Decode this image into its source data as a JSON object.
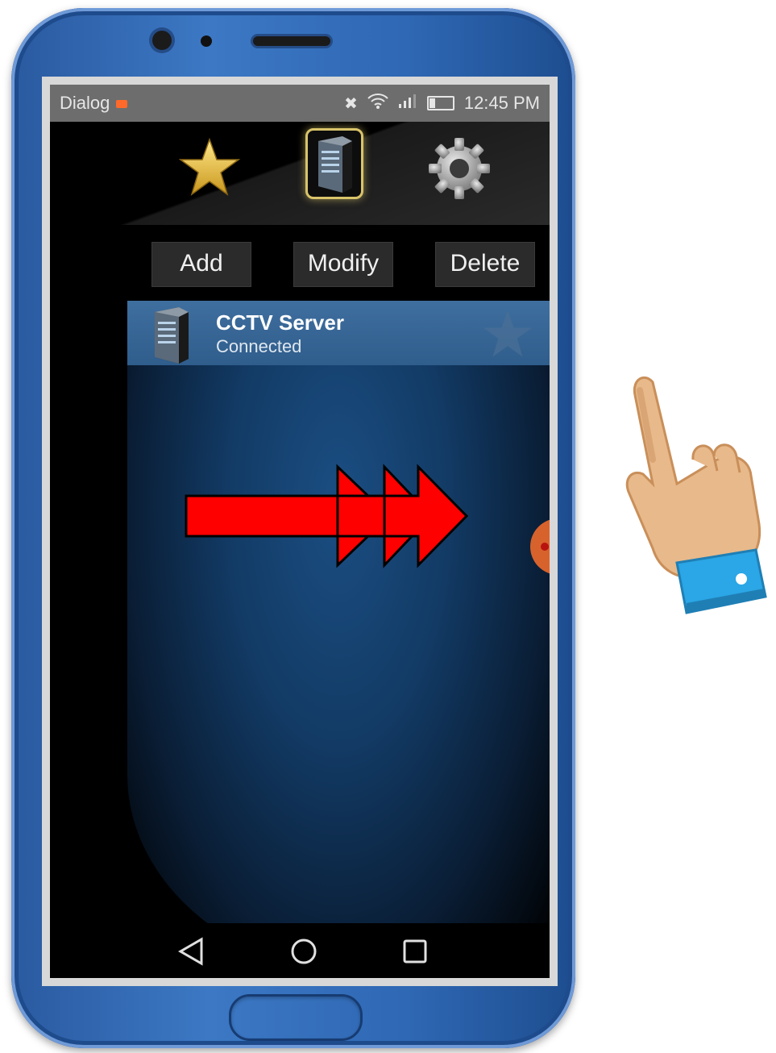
{
  "status_bar": {
    "carrier": "Dialog",
    "time": "12:45 PM",
    "icons": [
      "silent-icon",
      "wifi-icon",
      "signal-icon",
      "battery-icon"
    ]
  },
  "tabs": [
    {
      "name": "favorites",
      "icon": "star-icon"
    },
    {
      "name": "servers",
      "icon": "server-icon",
      "selected": true
    },
    {
      "name": "settings",
      "icon": "gear-icon"
    }
  ],
  "toolbar": {
    "add_label": "Add",
    "modify_label": "Modify",
    "delete_label": "Delete"
  },
  "server_list": [
    {
      "title": "CCTV Server",
      "status": "Connected",
      "favorite": false
    }
  ],
  "nav": [
    "back-icon",
    "home-icon",
    "recents-icon"
  ],
  "colors": {
    "phone_frame": "#2f68b4",
    "list_item_bg": "#2f5d8c",
    "arrow_red": "#ff0000",
    "star_gold": "#f0c640",
    "cuff_blue": "#2ba6e6",
    "skin": "#e8b98a"
  }
}
